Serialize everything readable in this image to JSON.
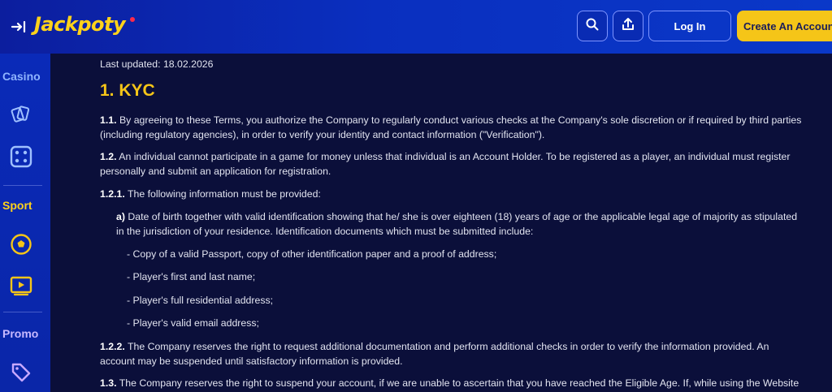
{
  "header": {
    "logo_text": "Jackpoty",
    "login_label": "Log In",
    "create_account_label": "Create An Account",
    "icons": [
      "collapse-menu-icon",
      "search-icon",
      "share-icon"
    ]
  },
  "sidebar": {
    "casino_label": "Casino",
    "sport_label": "Sport",
    "promo_label": "Promo",
    "icons": [
      "cards-icon",
      "dice-icon",
      "soccer-ball-icon",
      "live-video-icon",
      "tag-icon"
    ]
  },
  "document": {
    "last_updated": "Last updated: 18.02.2026",
    "section_title": "1. KYC",
    "p1_num": "1.1.",
    "p1_line1": "By agreeing to these Terms, you authorize the Company to regularly conduct various checks at the Company's sole discretion or if required by third parties",
    "p1_line2": "(including regulatory agencies), in order to verify your identity and contact information (\"Verification\").",
    "p2_num": "1.2.",
    "p2_line1": "An individual cannot participate in a game for money unless that individual is an Account Holder. To be registered as a player, an individual must register",
    "p2_line2": "personally and submit an application for registration.",
    "p3_num": "1.2.1.",
    "p3_text": "The following information must be provided:",
    "a_num": "a)",
    "a_line1": "Date of birth together with valid identification showing that he/ she is over eighteen (18) years of age or the applicable legal age of majority as stipulated",
    "a_line2": "in the jurisdiction of your residence. Identification documents which must be submitted include:",
    "bullet1": "- Copy of a valid Passport, copy of other identification paper and a proof of address;",
    "bullet2": "- Player's first and last name;",
    "bullet3": "- Player's full residential address;",
    "bullet4": "- Player's valid email address;",
    "p4_num": "1.2.2.",
    "p4_line1": "The Company reserves the right to request additional documentation and perform additional checks in order to verify the information provided. An",
    "p4_line2": "account may be suspended until satisfactory information is provided.",
    "p5_num": "1.3.",
    "p5_line1": "The Company reserves the right to suspend your account, if we are unable to ascertain that you have reached the Eligible Age. If, while using the Website"
  },
  "colors": {
    "accent_yellow": "#f5c518",
    "header_blue": "#0a2fbf",
    "background": "#0b0f3a"
  }
}
